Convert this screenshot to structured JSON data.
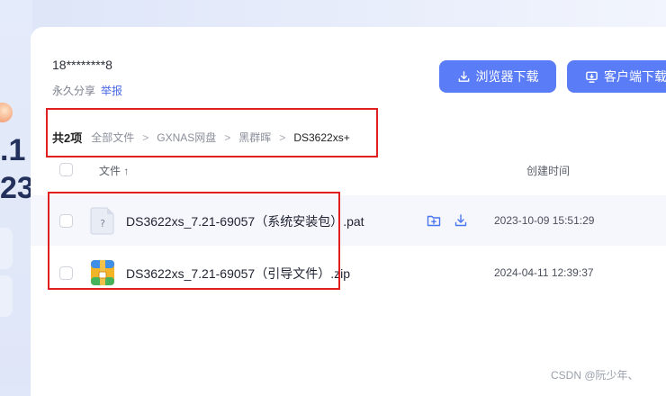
{
  "share": {
    "owner": "18********8",
    "validity": "永久分享",
    "report_label": "举报"
  },
  "buttons": {
    "browser_download": "浏览器下载",
    "client_download": "客户端下载"
  },
  "breadcrumb": {
    "count": "共2项",
    "items": [
      "全部文件",
      "GXNAS网盘",
      "黑群晖",
      "DS3622xs+"
    ],
    "separator": ">"
  },
  "table": {
    "col_name": "文件 ↑",
    "col_time": "创建时间",
    "rows": [
      {
        "name": "DS3622xs_7.21-69057（系统安装包）.pat",
        "time": "2023-10-09 15:51:29",
        "icon": "unknown-file-icon"
      },
      {
        "name": "DS3622xs_7.21-69057（引导文件）.zip",
        "time": "2024-04-11 12:39:37",
        "icon": "zip-archive-icon"
      }
    ]
  },
  "left_fragment": {
    "line1": ".1",
    "line2": "23"
  },
  "watermark": "CSDN @阮少年、",
  "colors": {
    "accent": "#5a7cf6",
    "highlight": "#e02020"
  }
}
